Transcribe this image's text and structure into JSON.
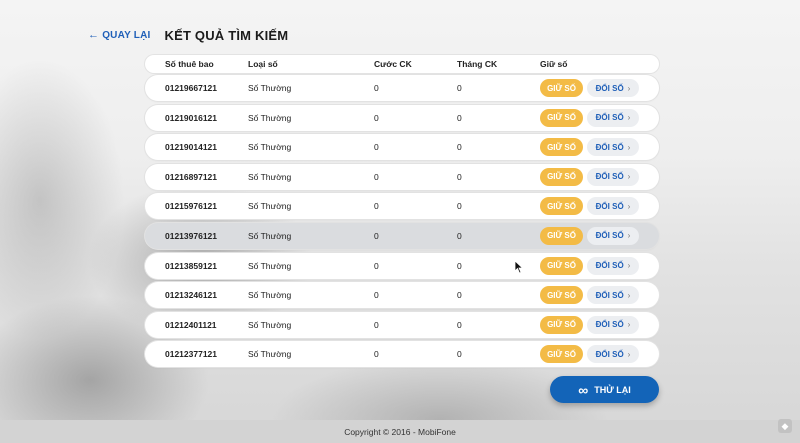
{
  "header": {
    "back_label": "QUAY LẠI",
    "title": "KẾT QUẢ TÌM KIẾM"
  },
  "table": {
    "columns": [
      "Số thuê bao",
      "Loại số",
      "Cước CK",
      "Tháng CK",
      "Giữ số"
    ],
    "rows": [
      {
        "number": "01219667121",
        "type": "Số Thường",
        "fee": "0",
        "months": "0"
      },
      {
        "number": "01219016121",
        "type": "Số Thường",
        "fee": "0",
        "months": "0"
      },
      {
        "number": "01219014121",
        "type": "Số Thường",
        "fee": "0",
        "months": "0"
      },
      {
        "number": "01216897121",
        "type": "Số Thường",
        "fee": "0",
        "months": "0"
      },
      {
        "number": "01215976121",
        "type": "Số Thường",
        "fee": "0",
        "months": "0"
      },
      {
        "number": "01213976121",
        "type": "Số Thường",
        "fee": "0",
        "months": "0"
      },
      {
        "number": "01213859121",
        "type": "Số Thường",
        "fee": "0",
        "months": "0"
      },
      {
        "number": "01213246121",
        "type": "Số Thường",
        "fee": "0",
        "months": "0"
      },
      {
        "number": "01212401121",
        "type": "Số Thường",
        "fee": "0",
        "months": "0"
      },
      {
        "number": "01212377121",
        "type": "Số Thường",
        "fee": "0",
        "months": "0"
      }
    ],
    "keep_label": "GIỮ SỐ",
    "change_label": "ĐỔI SỐ",
    "highlighted_row_index": 5
  },
  "retry_label": "THỬ LẠI",
  "footer": {
    "copyright": "Copyright © 2016 - MobiFone"
  },
  "colors": {
    "accent_blue": "#1364b8",
    "keep_yellow": "#f3bb46",
    "link_blue": "#1f5fb8"
  },
  "icons": {
    "back": "arrow-left-icon",
    "change": "chevron-right-icon",
    "retry": "infinity-icon"
  }
}
